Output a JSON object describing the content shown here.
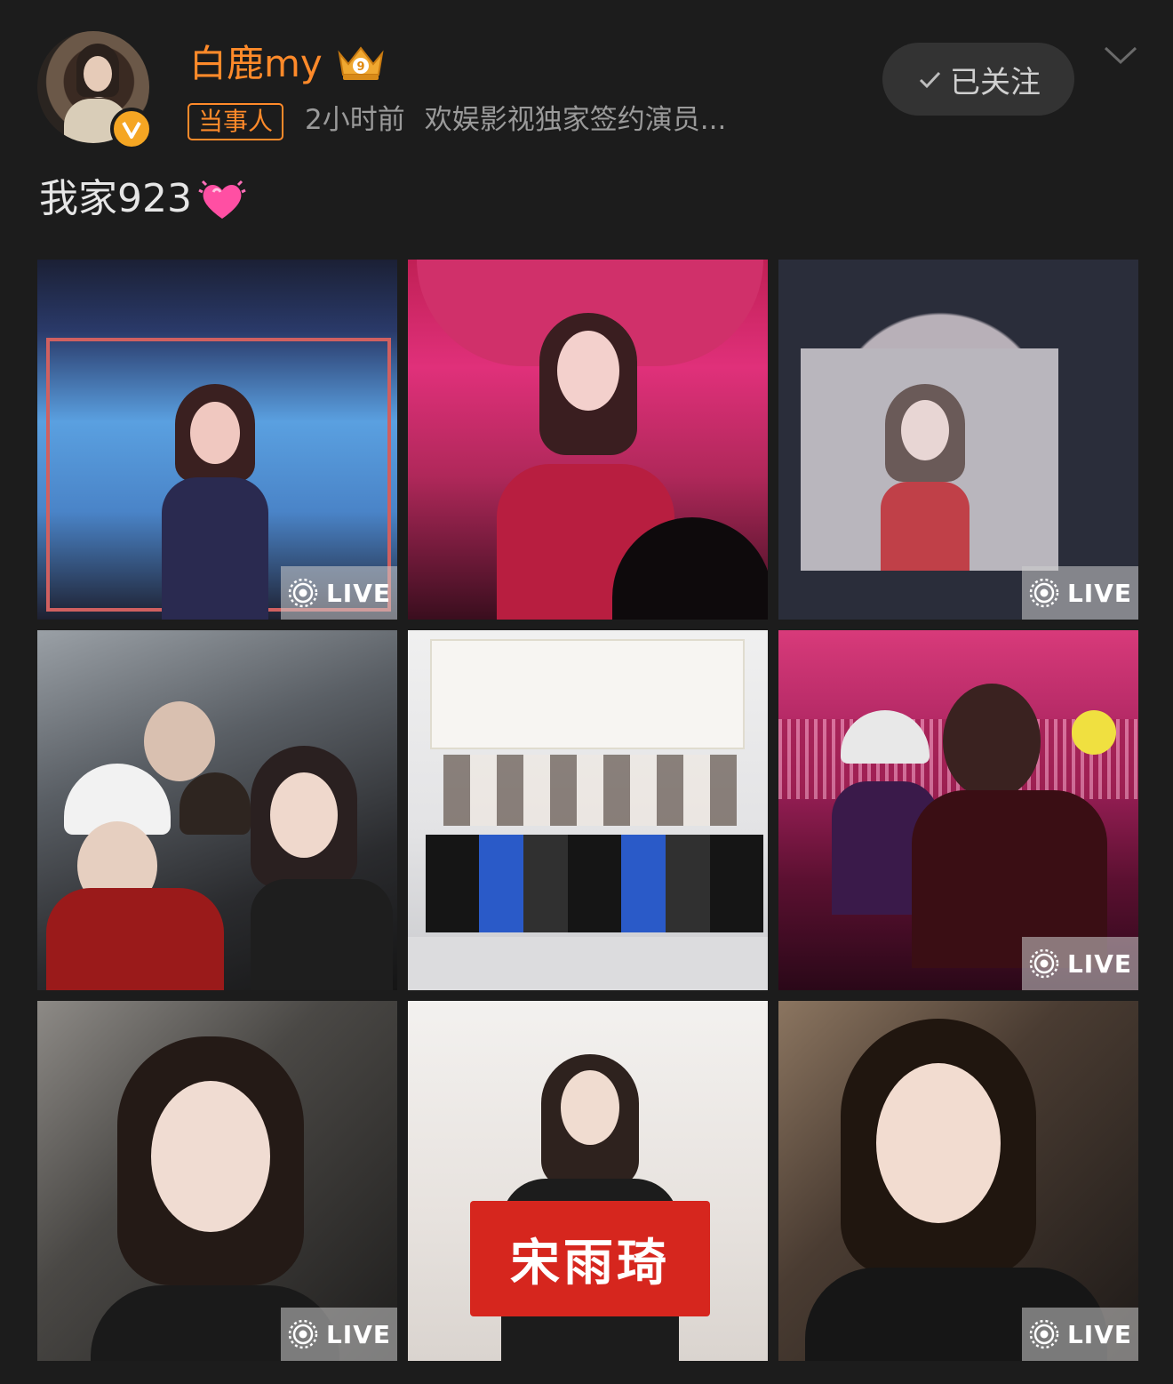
{
  "post": {
    "username": "白鹿my",
    "tag": "当事人",
    "time": "2小时前",
    "source": "欢娱影视独家签约演员...",
    "follow_label": "已关注",
    "text": "我家923"
  },
  "icons": {
    "avatar": "avatar",
    "verified": "verified-v-icon",
    "crown": "crown-level-9-icon",
    "check": "check-icon",
    "chevron": "chevron-down-icon",
    "heart": "growing-heart-emoji",
    "live": "live-photo-icon"
  },
  "colors": {
    "background": "#1c1c1c",
    "username": "#ff8a2a",
    "meta": "#9a9a9a",
    "follow_button": "#333333"
  },
  "photos": [
    {
      "id": "photo-1",
      "live_label": "LIVE"
    },
    {
      "id": "photo-2",
      "live_label": ""
    },
    {
      "id": "photo-3",
      "live_label": "LIVE"
    },
    {
      "id": "photo-4",
      "live_label": ""
    },
    {
      "id": "photo-5",
      "live_label": ""
    },
    {
      "id": "photo-6",
      "live_label": "LIVE"
    },
    {
      "id": "photo-7",
      "live_label": "LIVE"
    },
    {
      "id": "photo-8",
      "live_label": "",
      "banner_text": "宋雨琦"
    },
    {
      "id": "photo-9",
      "live_label": "LIVE"
    }
  ]
}
